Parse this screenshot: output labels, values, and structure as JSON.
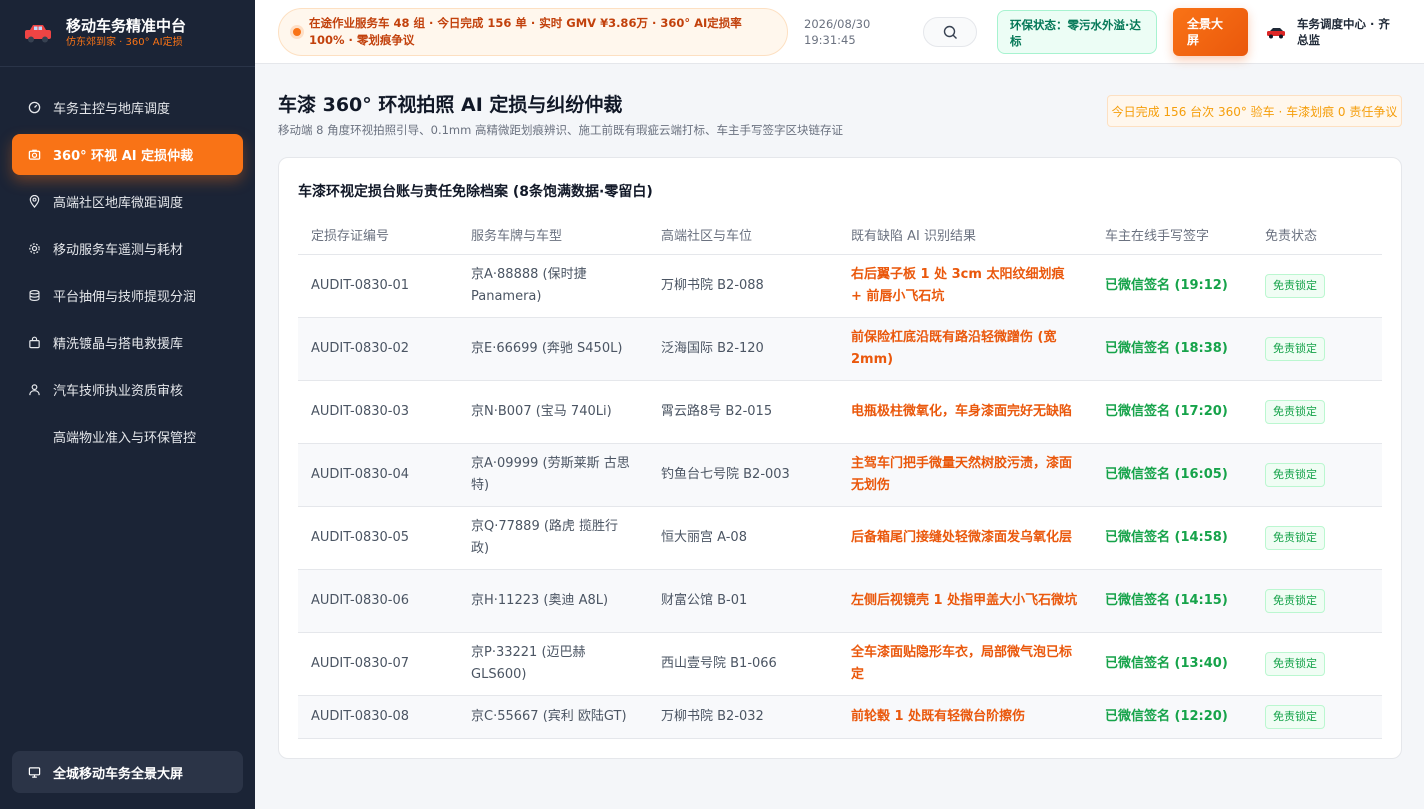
{
  "brand": {
    "title": "移动车务精准中台",
    "subtitle": "仿东郊到家 · 360° AI定损"
  },
  "sidebar": {
    "items": [
      {
        "label": "车务主控与地库调度",
        "icon": "dashboard-icon"
      },
      {
        "label": "360° 环视 AI 定损仲裁",
        "icon": "camera-icon",
        "active": true
      },
      {
        "label": "高端社区地库微距调度",
        "icon": "map-pin-icon"
      },
      {
        "label": "移动服务车遥测与耗材",
        "icon": "gear-icon"
      },
      {
        "label": "平台抽佣与技师提现分润",
        "icon": "database-icon"
      },
      {
        "label": "精洗镀晶与搭电救援库",
        "icon": "bag-icon"
      },
      {
        "label": "汽车技师执业资质审核",
        "icon": "user-icon"
      },
      {
        "label": "高端物业准入与环保管控",
        "icon": ""
      }
    ],
    "bottom_button": "全城移动车务全景大屏"
  },
  "header": {
    "ticker": "在途作业服务车 48 组 · 今日完成 156 单 · 实时 GMV ¥3.86万 · 360° AI定损率 100% · 零划痕争议",
    "date": "2026/08/30",
    "time": "19:31:45",
    "eco_status": "环保状态：零污水外溢·达标",
    "fullscreen_button": "全景大屏",
    "user_name": "车务调度中心 · 齐总监"
  },
  "page": {
    "title": "车漆 360° 环视拍照 AI 定损与纠纷仲裁",
    "subtitle": "移动端 8 角度环视拍照引导、0.1mm 高精微距划痕辨识、施工前既有瑕疵云端打标、车主手写签字区块链存证",
    "summary": "今日完成 156 台次 360° 验车 · 车漆划痕 0 责任争议"
  },
  "table": {
    "title": "车漆环视定损台账与责任免除档案 (8条饱满数据·零留白)",
    "columns": [
      "定损存证编号",
      "服务车牌与车型",
      "高端社区与车位",
      "既有缺陷 AI 识别结果",
      "车主在线手写签字",
      "免责状态"
    ],
    "rows": [
      [
        "AUDIT-0830-01",
        "京A·88888 (保时捷 Panamera)",
        "万柳书院 B2-088",
        "右后翼子板 1 处 3cm 太阳纹细划痕 + 前唇小飞石坑",
        "已微信签名 (19:12)",
        "免责锁定"
      ],
      [
        "AUDIT-0830-02",
        "京E·66699 (奔驰 S450L)",
        "泛海国际 B2-120",
        "前保险杠底沿既有路沿轻微蹭伤 (宽 2mm)",
        "已微信签名 (18:38)",
        "免责锁定"
      ],
      [
        "AUDIT-0830-03",
        "京N·B007 (宝马 740Li)",
        "霄云路8号 B2-015",
        "电瓶极柱微氧化，车身漆面完好无缺陷",
        "已微信签名 (17:20)",
        "免责锁定"
      ],
      [
        "AUDIT-0830-04",
        "京A·09999 (劳斯莱斯 古思特)",
        "钓鱼台七号院 B2-003",
        "主驾车门把手微量天然树胶污渍，漆面无划伤",
        "已微信签名 (16:05)",
        "免责锁定"
      ],
      [
        "AUDIT-0830-05",
        "京Q·77889 (路虎 揽胜行政)",
        "恒大丽宫 A-08",
        "后备箱尾门接缝处轻微漆面发乌氧化层",
        "已微信签名 (14:58)",
        "免责锁定"
      ],
      [
        "AUDIT-0830-06",
        "京H·11223 (奥迪 A8L)",
        "财富公馆 B-01",
        "左侧后视镜壳 1 处指甲盖大小飞石微坑",
        "已微信签名 (14:15)",
        "免责锁定"
      ],
      [
        "AUDIT-0830-07",
        "京P·33221 (迈巴赫 GLS600)",
        "西山壹号院 B1-066",
        "全车漆面贴隐形车衣，局部微气泡已标定",
        "已微信签名 (13:40)",
        "免责锁定"
      ],
      [
        "AUDIT-0830-08",
        "京C·55667 (宾利 欧陆GT)",
        "万柳书院 B2-032",
        "前轮毂 1 处既有轻微台阶擦伤",
        "已微信签名 (12:20)",
        "免责锁定"
      ]
    ]
  },
  "colors": {
    "accent": "#f97316",
    "sidebar_bg": "#1b2436",
    "success": "#16a34a",
    "warning_text": "#ea580c"
  }
}
